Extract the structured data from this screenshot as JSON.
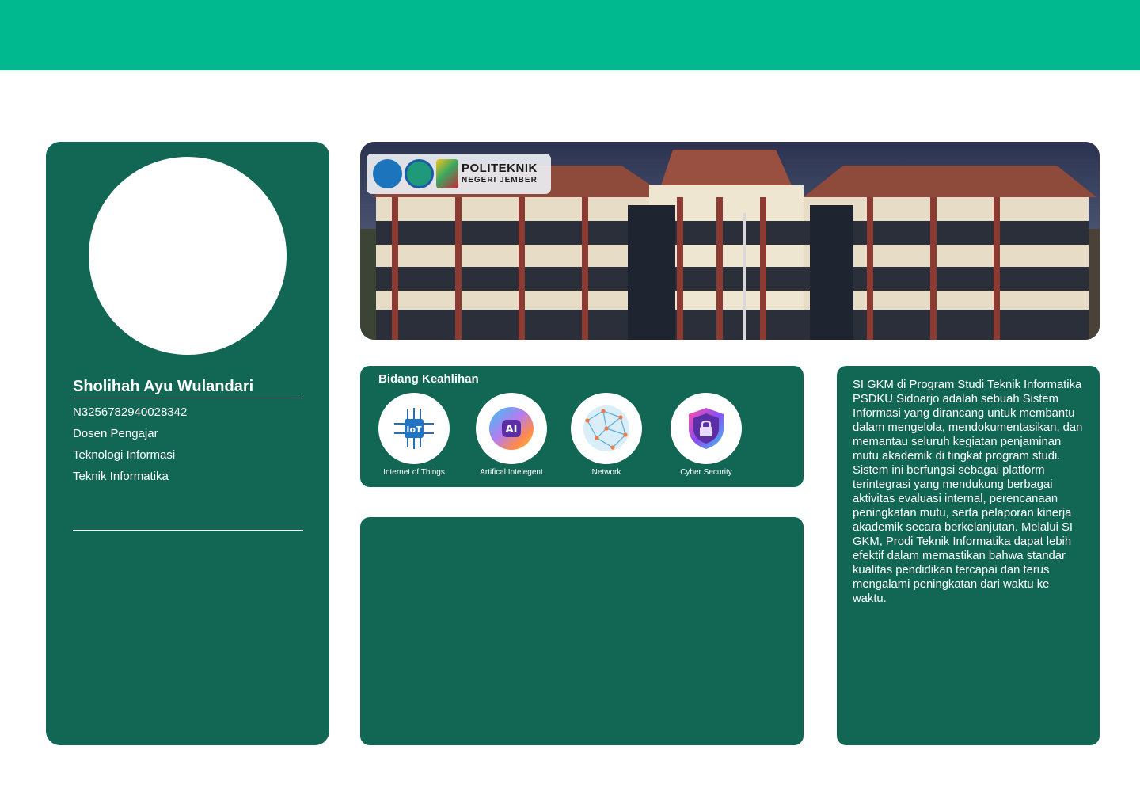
{
  "colors": {
    "accent": "#00b98e",
    "card": "#126654",
    "surface": "#ffffff"
  },
  "profile": {
    "name": "Sholihah Ayu Wulandari",
    "id_number": "N3256782940028342",
    "position": "Dosen Pengajar",
    "field": "Teknologi Informasi",
    "department": "Teknik Informatika"
  },
  "banner": {
    "logo_title": "POLITEKNIK",
    "logo_subtitle": "NEGERI JEMBER"
  },
  "skills": {
    "title": "Bidang Keahlihan",
    "items": [
      {
        "label": "Internet of Things",
        "icon": "iot-chip-icon"
      },
      {
        "label": "Artifical Intelegent",
        "icon": "ai-brain-icon"
      },
      {
        "label": "Network",
        "icon": "network-globe-icon"
      },
      {
        "label": "Cyber Security",
        "icon": "shield-lock-icon"
      }
    ]
  },
  "description": {
    "paragraph_1": "SI GKM di Program Studi Teknik Informatika PSDKU Sidoarjo adalah sebuah Sistem Informasi yang dirancang untuk membantu dalam mengelola, mendokumentasikan, dan memantau seluruh kegiatan penjaminan mutu akademik di tingkat program studi.",
    "paragraph_2": "Sistem ini berfungsi sebagai platform terintegrasi yang mendukung berbagai aktivitas evaluasi internal, perencanaan peningkatan mutu, serta pelaporan kinerja akademik secara berkelanjutan. Melalui SI GKM, Prodi Teknik Informatika dapat lebih efektif dalam memastikan bahwa standar kualitas pendidikan tercapai dan terus mengalami peningkatan dari waktu ke waktu."
  }
}
